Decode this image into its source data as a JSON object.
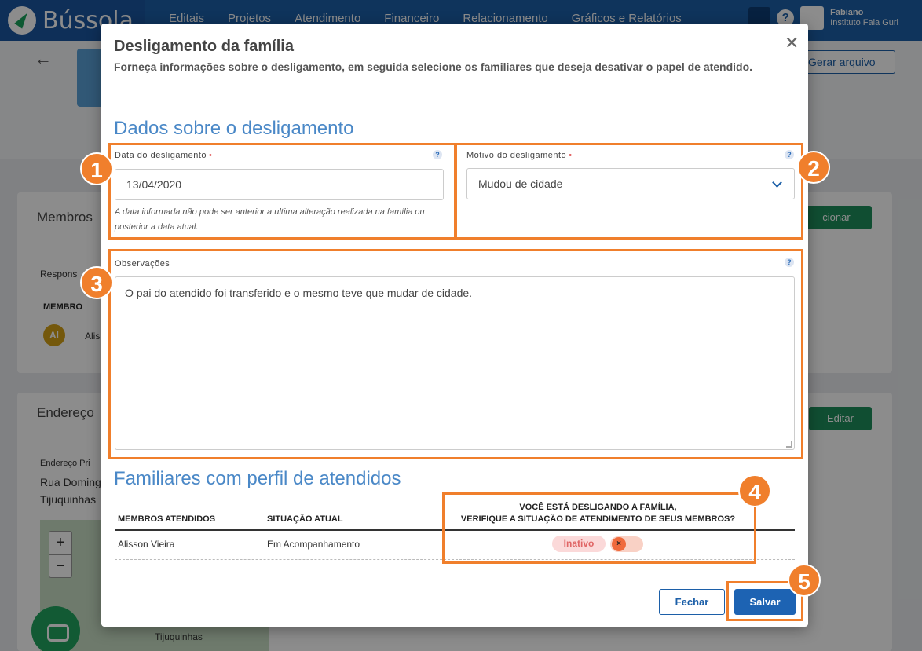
{
  "app": {
    "brand_name": "Bússola",
    "nav_items": [
      "Editais",
      "Projetos",
      "Atendimento",
      "Financeiro",
      "Relacionamento",
      "Gráficos e Relatórios"
    ],
    "user_name": "Fabiano",
    "user_org": "Instituto Fala Guri",
    "generate_button": "Gerar arquivo",
    "members_card_title": "Membros",
    "members_responsible_label": "Respons",
    "members_col_membro": "MEMBRO",
    "member_initials": "Al",
    "member_partial_name": "Alis",
    "add_button_partial": "cionar",
    "address_card_title": "Endereço",
    "edit_button": "Editar",
    "address_label_partial": "Endereço Pri",
    "address_line1_partial": "Rua Doming",
    "address_line2_partial": "Tijuquinhas",
    "map_label": "Tijuquinhas",
    "zoom_in": "+",
    "zoom_out": "−"
  },
  "modal": {
    "title": "Desligamento da família",
    "subtitle": "Forneça informações sobre o desligamento, em seguida selecione os familiares que deseja desativar o papel de atendido.",
    "close_glyph": "✕",
    "section1_title": "Dados sobre o desligamento",
    "date_label": "Data do desligamento",
    "date_value": "13/04/2020",
    "date_hint": "A data informada não pode ser anterior a ultima alteração realizada na família ou posterior a data atual.",
    "reason_label": "Motivo do desligamento",
    "reason_value": "Mudou de cidade",
    "required_mark": "•",
    "help_glyph": "?",
    "notes_label": "Observações",
    "notes_value": "O pai do atendido foi transferido e o mesmo teve que mudar de cidade.",
    "section2_title": "Familiares com perfil de atendidos",
    "table": {
      "col_members": "MEMBROS ATENDIDOS",
      "col_status": "SITUAÇÃO ATUAL",
      "col_action_line1": "VOCÊ ESTÁ DESLIGANDO A FAMÍLIA,",
      "col_action_line2": "VERIFIQUE A SITUAÇÃO DE ATENDIMENTO DE SEUS MEMBROS?",
      "rows": [
        {
          "member": "Alisson Vieira",
          "status": "Em Acompanhamento",
          "badge": "Inativo",
          "toggle_glyph": "×",
          "toggle_on": false
        }
      ]
    },
    "btn_close": "Fechar",
    "btn_save": "Salvar"
  },
  "callouts": [
    "1",
    "2",
    "3",
    "4",
    "5"
  ],
  "colors": {
    "accent_blue": "#1d63b3",
    "callout_orange": "#f07f2c",
    "section_title_blue": "#4a88c7",
    "inactive_red": "#e06666"
  }
}
